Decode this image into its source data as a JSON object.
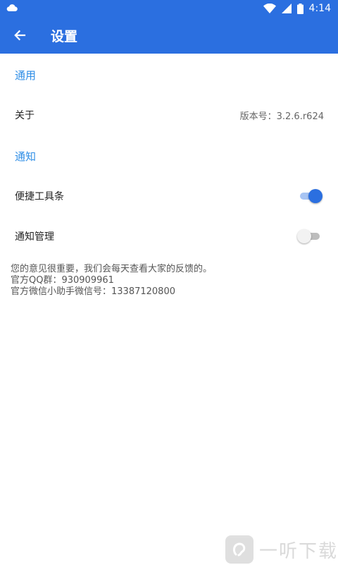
{
  "status_bar": {
    "time": "4:14",
    "icons": [
      "cloud-icon",
      "wifi-icon",
      "signal-icon",
      "battery-icon"
    ]
  },
  "app_bar": {
    "title": "设置",
    "back_icon": "arrow-left-icon"
  },
  "sections": {
    "general": {
      "header": "通用"
    },
    "notify": {
      "header": "通知"
    }
  },
  "about": {
    "label": "关于",
    "value": "版本号：3.2.6.r624"
  },
  "toolbar_toggle": {
    "label": "便捷工具条",
    "checked": true
  },
  "notify_manage": {
    "label": "通知管理",
    "checked": false
  },
  "feedback": {
    "line1": "您的意见很重要，我们会每天查看大家的反馈的。",
    "line2": "官方QQ群：930909961",
    "line3": "官方微信小助手微信号：13387120800"
  },
  "watermark": {
    "text": "一听下载"
  },
  "colors": {
    "primary": "#2b6fe0",
    "section_header": "#2f8ee6"
  }
}
